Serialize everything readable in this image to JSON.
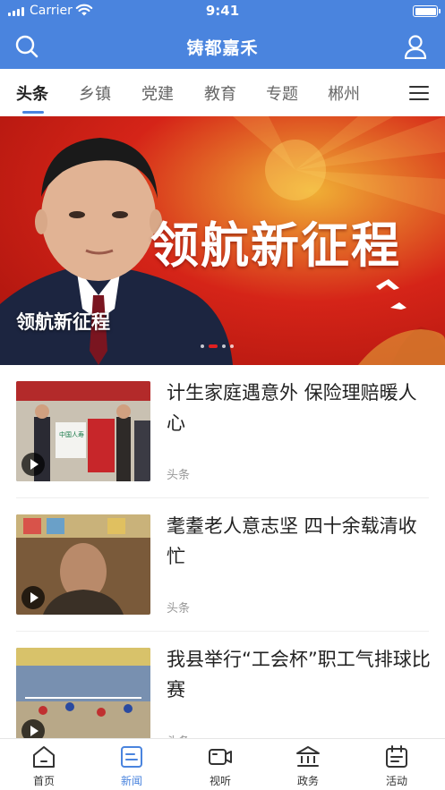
{
  "status_bar": {
    "carrier": "Carrier",
    "time": "9:41"
  },
  "app_bar": {
    "title": "铸都嘉禾"
  },
  "tabs": [
    {
      "label": "头条",
      "active": true
    },
    {
      "label": "乡镇"
    },
    {
      "label": "党建"
    },
    {
      "label": "教育"
    },
    {
      "label": "专题"
    },
    {
      "label": "郴州"
    }
  ],
  "banner": {
    "headline": "领航新征程",
    "caption": "领航新征程",
    "page_count": 4,
    "active_index": 1
  },
  "news": [
    {
      "title": "计生家庭遇意外 保险理赔暖人心",
      "tag": "头条",
      "thumb_text": "中国人寿"
    },
    {
      "title": "耄耋老人意志坚 四十余载清收忙",
      "tag": "头条"
    },
    {
      "title": "我县举行“工会杯”职工气排球比赛",
      "tag": "头条"
    }
  ],
  "bottom_nav": [
    {
      "label": "首页",
      "icon": "home-icon"
    },
    {
      "label": "新闻",
      "icon": "news-icon",
      "active": true
    },
    {
      "label": "视听",
      "icon": "video-icon"
    },
    {
      "label": "政务",
      "icon": "government-icon"
    },
    {
      "label": "活动",
      "icon": "calendar-icon"
    }
  ],
  "colors": {
    "accent": "#4a84de",
    "banner_red": "#d52418"
  }
}
